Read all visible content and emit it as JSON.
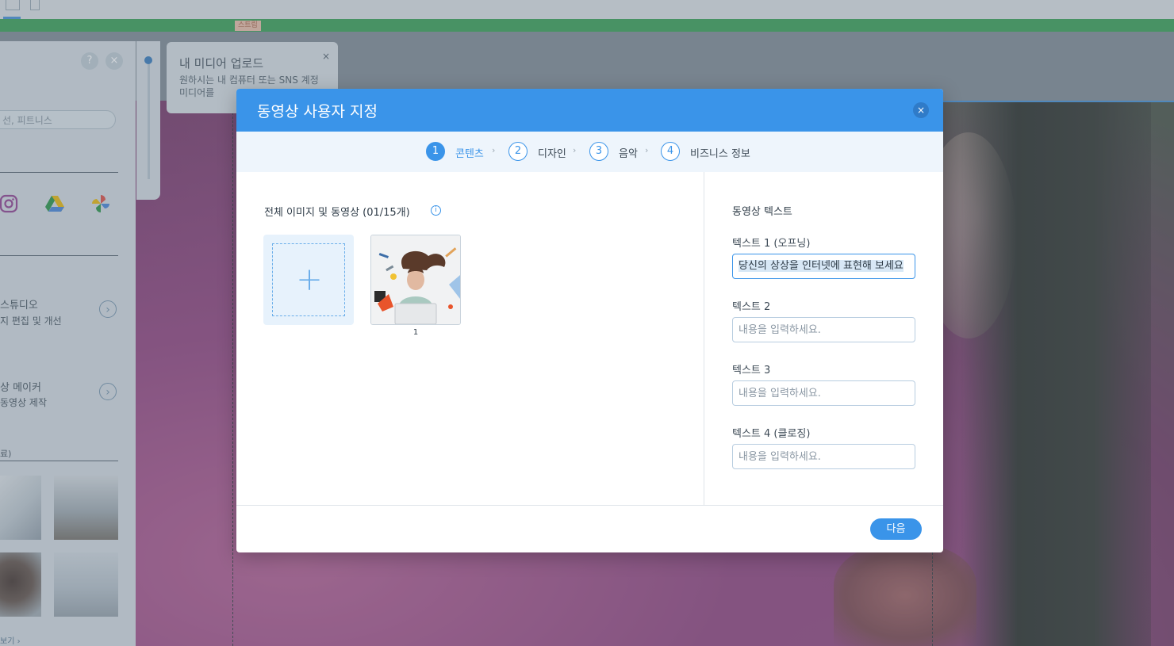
{
  "editor": {
    "strip_tag": "스트립",
    "upload_tip": {
      "title": "내 미디어 업로드",
      "body": "원하시는 내 컴퓨터 또는 SNS 계정 미디어를",
      "close": "×"
    },
    "panel": {
      "help": "?",
      "close": "×",
      "search_placeholder": "선, 피트니스",
      "sources": [
        "instagram-icon",
        "google-drive-icon",
        "google-photos-icon"
      ],
      "items": [
        {
          "title": "스튜디오",
          "subtitle": "지 편집 및 개선"
        },
        {
          "title": "상 메이커",
          "subtitle": "동영상 제작"
        }
      ],
      "section_label": "료)",
      "more_link": "보기 ›"
    }
  },
  "dialog": {
    "title": "동영상 사용자 지정",
    "close": "×",
    "steps": [
      {
        "num": "1",
        "label": "콘텐츠",
        "active": true
      },
      {
        "num": "2",
        "label": "디자인",
        "active": false
      },
      {
        "num": "3",
        "label": "음악",
        "active": false
      },
      {
        "num": "4",
        "label": "비즈니스 정보",
        "active": false
      }
    ],
    "media": {
      "title": "전체 이미지 및 동영상 (01/15개)",
      "info": "i",
      "add": "+",
      "item_number": "1"
    },
    "texts": {
      "title": "동영상 텍스트",
      "fields": [
        {
          "label": "텍스트 1 (오프닝)",
          "value": "당신의 상상을 인터넷에 표현해 보세요",
          "placeholder": ""
        },
        {
          "label": "텍스트 2",
          "value": "",
          "placeholder": "내용을 입력하세요."
        },
        {
          "label": "텍스트 3",
          "value": "",
          "placeholder": "내용을 입력하세요."
        },
        {
          "label": "텍스트 4 (클로징)",
          "value": "",
          "placeholder": "내용을 입력하세요."
        }
      ]
    },
    "next_label": "다음"
  },
  "colors": {
    "accent": "#3a94e9",
    "strip": "#2f9a4e"
  }
}
